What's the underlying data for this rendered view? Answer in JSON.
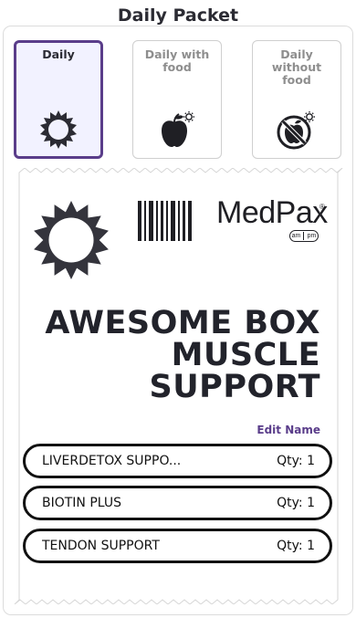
{
  "header": {
    "title": "Daily Packet"
  },
  "options": [
    {
      "label": "Daily",
      "icon": "sun-icon",
      "selected": true
    },
    {
      "label": "Daily with food",
      "icon": "apple-sun-icon",
      "selected": false
    },
    {
      "label": "Daily without food",
      "icon": "no-food-icon",
      "selected": false
    }
  ],
  "packet": {
    "brand": "MedPax",
    "brand_reg": "®",
    "pill_am": "am",
    "pill_pm": "pm",
    "name": "AWESOME BOX MUSCLE SUPPORT",
    "edit_label": "Edit Name",
    "items": [
      {
        "name": "LIVERDETOX SUPPO...",
        "qty": "Qty: 1"
      },
      {
        "name": "BIOTIN PLUS",
        "qty": "Qty: 1"
      },
      {
        "name": "TENDON SUPPORT",
        "qty": "Qty: 1"
      }
    ]
  },
  "colors": {
    "accent": "#5a3d8a",
    "selected_bg": "#f2f2ff",
    "text": "#2b2b33"
  }
}
